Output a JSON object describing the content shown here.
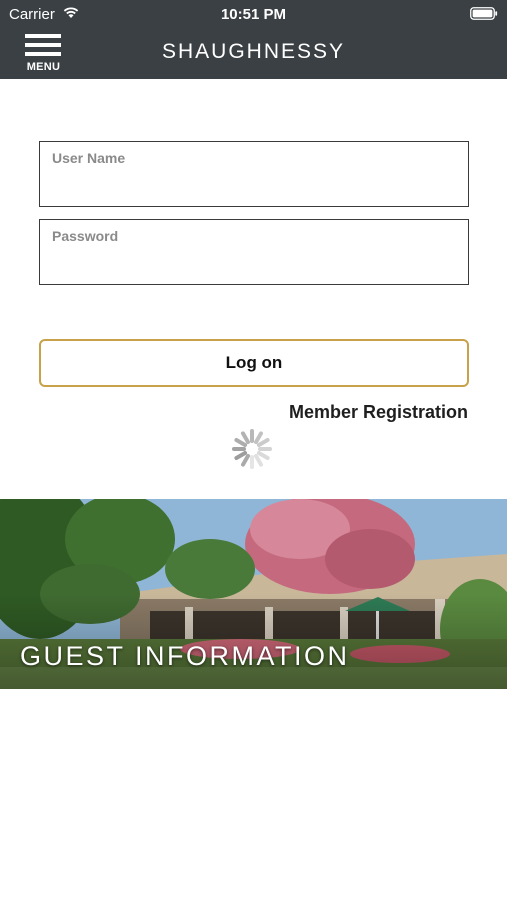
{
  "status_bar": {
    "carrier": "Carrier",
    "time": "10:51 PM"
  },
  "nav": {
    "menu_label": "MENU",
    "title": "SHAUGHNESSY"
  },
  "login": {
    "username_placeholder": "User Name",
    "username_value": "",
    "password_placeholder": "Password",
    "password_value": "",
    "logon_label": "Log on",
    "register_label": "Member Registration"
  },
  "banner": {
    "label": "GUEST INFORMATION"
  },
  "colors": {
    "header_bg": "#3b4044",
    "accent_gold": "#c8a24a",
    "field_border": "#3a3a3a"
  }
}
